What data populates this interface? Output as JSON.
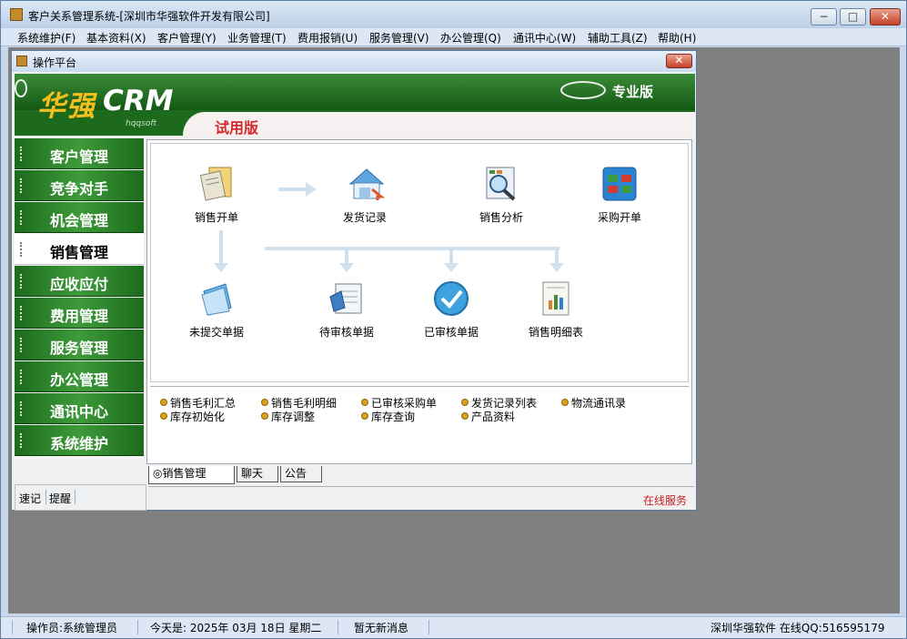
{
  "window": {
    "title": "客户关系管理系统-[深圳市华强软件开发有限公司]"
  },
  "menu": [
    "系统维护(F)",
    "基本资料(X)",
    "客户管理(Y)",
    "业务管理(T)",
    "费用报销(U)",
    "服务管理(V)",
    "办公管理(Q)",
    "通讯中心(W)",
    "辅助工具(Z)",
    "帮助(H)"
  ],
  "panel": {
    "title": "操作平台"
  },
  "banner": {
    "logo_cn": "华强",
    "logo_en": "CRM",
    "sub": "hqqsoft",
    "edition": "专业版",
    "trial": "试用版"
  },
  "sidebar": {
    "items": [
      "客户管理",
      "竞争对手",
      "机会管理",
      "销售管理",
      "应收应付",
      "费用管理",
      "服务管理",
      "办公管理",
      "通讯中心",
      "系统维护"
    ],
    "active_index": 3,
    "bottom": [
      "速记",
      "提醒"
    ]
  },
  "flow": {
    "nodes": [
      "销售开单",
      "发货记录",
      "销售分析",
      "采购开单",
      "未提交单据",
      "待审核单据",
      "已审核单据",
      "销售明细表"
    ]
  },
  "links": {
    "row1": [
      "销售毛利汇总",
      "销售毛利明细",
      "已审核采购单",
      "发货记录列表",
      "物流通讯录"
    ],
    "row2": [
      "库存初始化",
      "库存调整",
      "库存查询",
      "产品资料"
    ]
  },
  "tabs": [
    "◎销售管理",
    "聊天",
    "公告"
  ],
  "online_service": "在线服务",
  "status": {
    "operator": "操作员:系统管理员",
    "date": "今天是: 2025年 03月 18日  星期二",
    "messages": "暂无新消息",
    "company": "深圳华强软件 在线QQ:516595179"
  },
  "colors": {
    "sidebar_green": "#2a7d2a",
    "trial_red": "#d42a2a",
    "link_bullet": "#d9a11a"
  }
}
